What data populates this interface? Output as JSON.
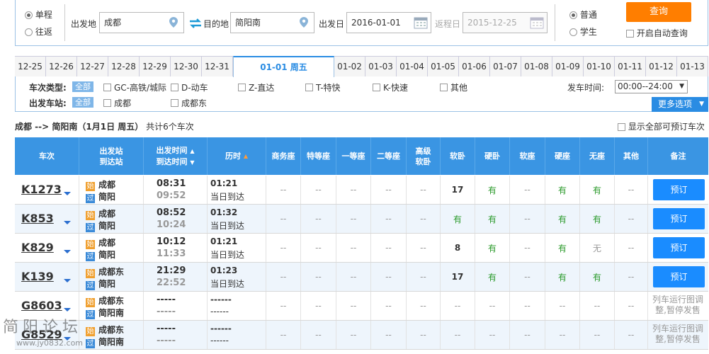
{
  "search": {
    "trip_one_way": "单程",
    "trip_round": "往返",
    "from_label": "出发地",
    "from_value": "成都",
    "to_label": "目的地",
    "to_value": "简阳南",
    "depart_label": "出发日",
    "depart_value": "2016-01-01",
    "return_label": "返程日",
    "return_value": "2015-12-25",
    "pass_normal": "普通",
    "pass_student": "学生",
    "query_button": "查询",
    "auto_query": "开启自动查询"
  },
  "dates": [
    "12-25",
    "12-26",
    "12-27",
    "12-28",
    "12-29",
    "12-30",
    "12-31",
    "01-01 周五",
    "01-02",
    "01-03",
    "01-04",
    "01-05",
    "01-06",
    "01-07",
    "01-08",
    "01-09",
    "01-10",
    "01-11",
    "01-12",
    "01-13"
  ],
  "filters": {
    "type_label": "车次类型:",
    "station_label": "出发车站:",
    "all_tag": "全部",
    "types": [
      "GC-高铁/城际",
      "D-动车",
      "Z-直达",
      "T-特快",
      "K-快速",
      "其他"
    ],
    "stations": [
      "成都",
      "成都东"
    ],
    "time_label": "发车时间:",
    "time_value": "00:00--24:00",
    "more_options": "更多选项"
  },
  "summary": {
    "route": "成都 --> 简阳南（1月1日  周五）",
    "count_text": "共计6个车次",
    "show_all": "显示全部可预订车次"
  },
  "table": {
    "headers": {
      "train": "车次",
      "station_from": "出发站",
      "station_to": "到达站",
      "time_depart": "出发时间",
      "time_arrive": "到达时间",
      "duration": "历时",
      "business": "商务座",
      "special": "特等座",
      "first": "一等座",
      "second": "二等座",
      "premium_a": "高级",
      "premium_b": "软卧",
      "soft_sleeper": "软卧",
      "hard_sleeper": "硬卧",
      "soft_seat": "软座",
      "hard_seat": "硬座",
      "no_seat": "无座",
      "other": "其他",
      "remark": "备注"
    },
    "rows": [
      {
        "no": "K1273",
        "from_badge": "始",
        "from": "成都",
        "to_badge": "过",
        "to": "简阳",
        "dep": "08:31",
        "arr": "09:52",
        "dur": "01:21",
        "dur_note": "当日到达",
        "seats": [
          "--",
          "--",
          "--",
          "--",
          "--",
          "17",
          "有",
          "--",
          "有",
          "有",
          "--"
        ],
        "action": "预订",
        "remark": ""
      },
      {
        "no": "K853",
        "from_badge": "始",
        "from": "成都",
        "to_badge": "过",
        "to": "简阳",
        "dep": "08:52",
        "arr": "10:24",
        "dur": "01:32",
        "dur_note": "当日到达",
        "seats": [
          "--",
          "--",
          "--",
          "--",
          "--",
          "有",
          "有",
          "--",
          "有",
          "有",
          "--"
        ],
        "action": "预订",
        "remark": ""
      },
      {
        "no": "K829",
        "from_badge": "始",
        "from": "成都",
        "to_badge": "过",
        "to": "简阳",
        "dep": "10:12",
        "arr": "11:33",
        "dur": "01:21",
        "dur_note": "当日到达",
        "seats": [
          "--",
          "--",
          "--",
          "--",
          "--",
          "8",
          "有",
          "--",
          "有",
          "无",
          "--"
        ],
        "action": "预订",
        "remark": ""
      },
      {
        "no": "K139",
        "from_badge": "始",
        "from": "成都东",
        "to_badge": "过",
        "to": "简阳",
        "dep": "21:29",
        "arr": "22:52",
        "dur": "01:23",
        "dur_note": "当日到达",
        "seats": [
          "--",
          "--",
          "--",
          "--",
          "--",
          "17",
          "有",
          "--",
          "有",
          "有",
          "--"
        ],
        "action": "预订",
        "remark": ""
      },
      {
        "no": "G8603",
        "from_badge": "始",
        "from": "成都东",
        "to_badge": "过",
        "to": "简阳南",
        "dep": "-----",
        "arr": "-----",
        "dur": "------",
        "dur_note": "------",
        "seats": [
          "--",
          "--",
          "--",
          "--",
          "--",
          "--",
          "--",
          "--",
          "--",
          "--",
          "--"
        ],
        "action": "",
        "remark": "列车运行图调整,暂停发售"
      },
      {
        "no": "G8529",
        "from_badge": "始",
        "from": "成都东",
        "to_badge": "过",
        "to": "简阳南",
        "dep": "-----",
        "arr": "-----",
        "dur": "------",
        "dur_note": "------",
        "seats": [
          "--",
          "--",
          "--",
          "--",
          "--",
          "--",
          "--",
          "--",
          "--",
          "--",
          "--"
        ],
        "action": "",
        "remark": "列车运行图调整,暂停发售"
      }
    ]
  },
  "watermark": {
    "line1": "简阳论坛",
    "line2": "www.jy0832.com"
  },
  "colors": {
    "accent": "#2a8ce3",
    "header": "#3a95e3",
    "button": "#1a8cff",
    "query": "#ff7e00",
    "available": "#2a9a2a",
    "badge_start": "#f0a030",
    "badge_pass": "#3a8ad8"
  }
}
